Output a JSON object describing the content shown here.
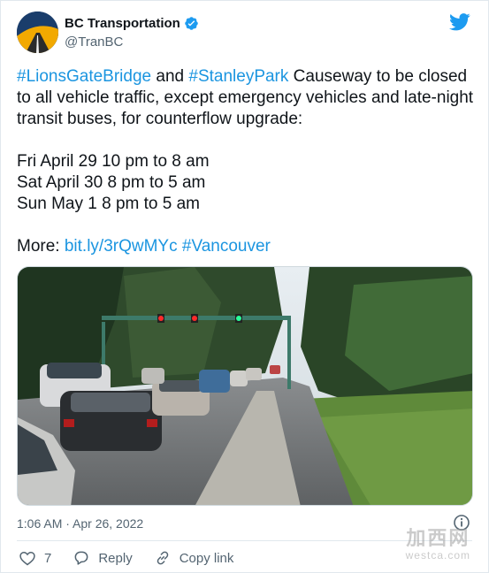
{
  "author": {
    "name": "BC Transportation",
    "handle": "@TranBC"
  },
  "tweet": {
    "hashtag1": "#LionsGateBridge",
    "and": " and ",
    "hashtag2": "#StanleyPark",
    "text1": " Causeway to be closed to all vehicle traffic, except emergency vehicles and late-night transit buses, for counterflow upgrade:",
    "schedule": [
      "Fri April 29 10 pm to 8 am",
      "Sat April 30 8 pm to 5 am",
      "Sun May 1 8 pm to 5 am"
    ],
    "more_label": "More: ",
    "link": "bit.ly/3rQwMYc",
    "hashtag3": "#Vancouver"
  },
  "timestamp": "1:06 AM · Apr 26, 2022",
  "actions": {
    "likes": "7",
    "reply": "Reply",
    "copy_link": "Copy link"
  },
  "watermark": {
    "chinese": "加西网",
    "url": "westca.com"
  },
  "colors": {
    "link": "#1b95e0",
    "verified": "#1d9bf0",
    "twitter": "#1d9bf0"
  }
}
